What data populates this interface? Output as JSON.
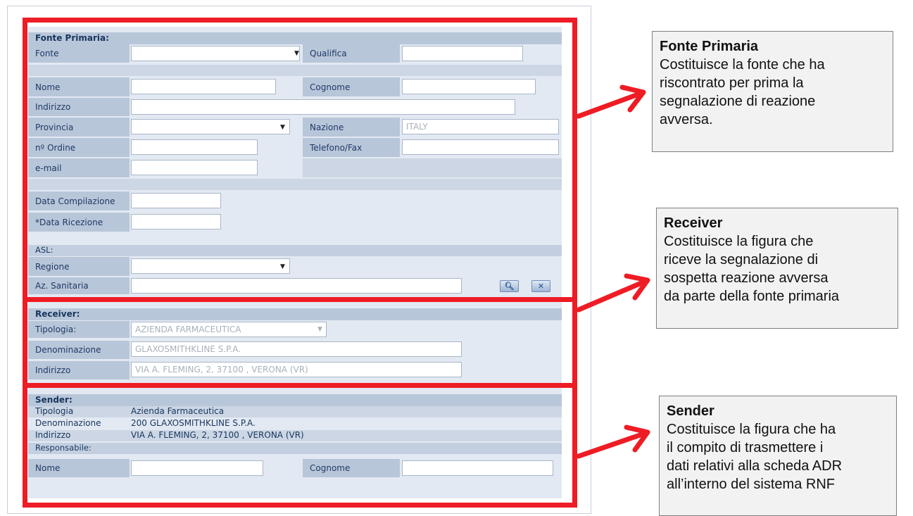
{
  "fonte_primaria": {
    "header": "Fonte Primaria:",
    "fonte_label": "Fonte",
    "fonte_value": "",
    "qualifica_label": "Qualifica",
    "qualifica_value": "",
    "nome_label": "Nome",
    "nome_value": "",
    "cognome_label": "Cognome",
    "cognome_value": "",
    "indirizzo_label": "Indirizzo",
    "indirizzo_value": "",
    "provincia_label": "Provincia",
    "provincia_value": "",
    "nazione_label": "Nazione",
    "nazione_value": "ITALY",
    "ordine_label": "nº Ordine",
    "ordine_value": "",
    "telefono_label": "Telefono/Fax",
    "telefono_value": "",
    "email_label": "e-mail",
    "email_value": "",
    "data_compilazione_label": "Data Compilazione",
    "data_compilazione_value": "",
    "data_ricezione_label": "*Data Ricezione",
    "data_ricezione_value": "",
    "asl_header": "ASL:",
    "regione_label": "Regione",
    "regione_value": "",
    "az_sanitaria_label": "Az. Sanitaria",
    "az_sanitaria_value": ""
  },
  "receiver": {
    "header": "Receiver:",
    "tipologia_label": "Tipologia:",
    "tipologia_value": "AZIENDA FARMACEUTICA",
    "denominazione_label": "Denominazione",
    "denominazione_value": "GLAXOSMITHKLINE S.P.A.",
    "indirizzo_label": "Indirizzo",
    "indirizzo_value": "VIA A. FLEMING, 2, 37100 , VERONA (VR)"
  },
  "sender": {
    "header": "Sender:",
    "tipologia_label": "Tipologia",
    "tipologia_value": "Azienda Farmaceutica",
    "denominazione_label": "Denominazione",
    "denominazione_value": "200 GLAXOSMITHKLINE S.P.A.",
    "indirizzo_label": "Indirizzo",
    "indirizzo_value": "VIA A. FLEMING, 2, 37100 , VERONA (VR)",
    "responsabile_header": "Responsabile:",
    "nome_label": "Nome",
    "nome_value": "",
    "cognome_label": "Cognome",
    "cognome_value": ""
  },
  "callouts": {
    "fonte": {
      "title": "Fonte Primaria",
      "lines": [
        "Costituisce la fonte che ha",
        "riscontrato per prima la",
        "segnalazione di reazione",
        "avversa."
      ]
    },
    "receiver": {
      "title": "Receiver",
      "lines": [
        "Costituisce la figura che",
        "riceve la segnalazione di",
        "sospetta reazione avversa",
        "da parte della fonte primaria"
      ]
    },
    "sender": {
      "title": "Sender",
      "lines": [
        "Costituisce la figura che ha",
        "il compito di trasmettere i",
        "dati relativi alla scheda ADR",
        "all’interno del sistema RNF"
      ]
    }
  },
  "icons": {
    "search": "search-icon",
    "clear": "clear-icon",
    "dropdown": "chevron-down-icon"
  },
  "colors": {
    "highlight": "#ee1c24",
    "label_bg": "#b8c6d9",
    "form_bg": "#e3e9f2"
  }
}
